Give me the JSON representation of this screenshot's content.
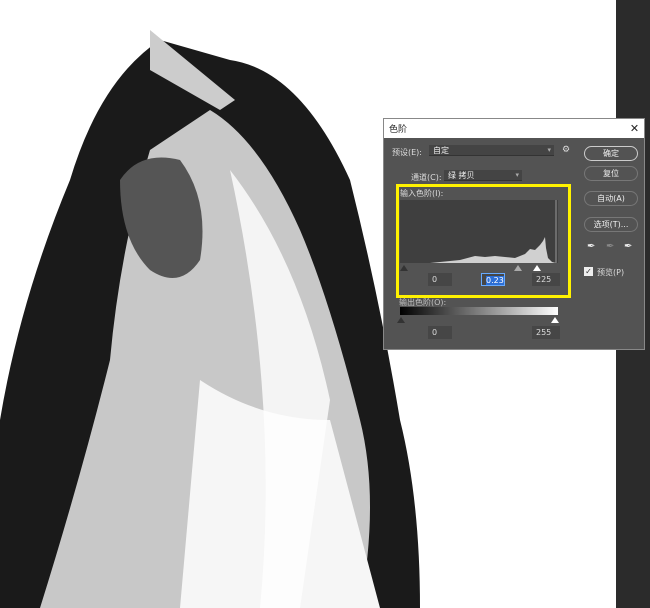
{
  "dialog": {
    "title": "色阶",
    "close_icon": "close-icon",
    "preset": {
      "label": "预设(E):",
      "value": "自定"
    },
    "channel": {
      "label": "通道(C):",
      "value": "绿 拷贝"
    },
    "input_levels": {
      "label": "输入色阶(I):",
      "black": "0",
      "gamma": "0.23",
      "white": "225"
    },
    "output_levels": {
      "label": "输出色阶(O):",
      "black": "0",
      "white": "255"
    },
    "buttons": {
      "ok": "确定",
      "reset": "复位",
      "auto": "自动(A)",
      "options": "选项(T)..."
    },
    "preview": {
      "label": "预览(P)",
      "checked": true
    },
    "highlight_color": "#fff200"
  }
}
